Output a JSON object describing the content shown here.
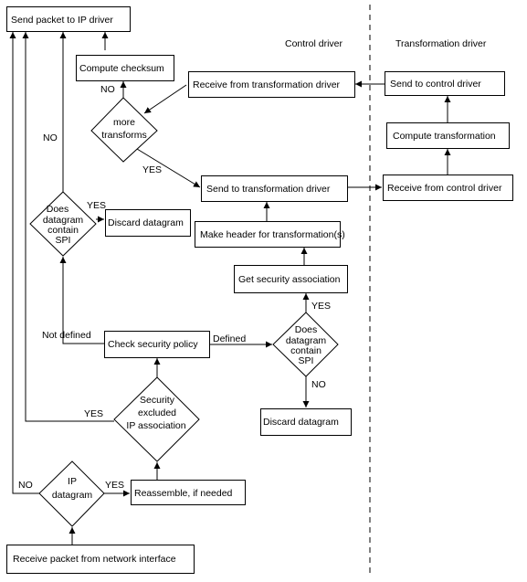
{
  "lanes": {
    "control": "Control driver",
    "transformation": "Transformation driver"
  },
  "boxes": {
    "send_ip": "Send packet to IP driver",
    "checksum": "Compute  checksum",
    "recv_transform": "Receive from transformation driver",
    "send_control": "Send to control driver",
    "compute_transform": "Compute  transformation",
    "recv_control": "Receive from control driver",
    "send_transform": "Send to transformation driver",
    "make_header": "Make header for transformation(s)",
    "get_sa": "Get security association",
    "discard_left": "Discard  datagram",
    "check_policy": "Check security policy",
    "discard_right": "Discard  datagram",
    "reassemble": "Reassemble,  if  needed",
    "recv_packet": "Receive packet  from network interface"
  },
  "decisions": {
    "more_transforms": [
      "more",
      "transforms"
    ],
    "spi_left": [
      "Does",
      "datagram",
      "contain",
      "SPI"
    ],
    "spi_right": [
      "Does",
      "datagram",
      "contain",
      "SPI"
    ],
    "security_excluded": [
      "Security",
      "excluded",
      "IP  association"
    ],
    "ip_datagram": [
      "IP",
      "datagram"
    ]
  },
  "labels": {
    "no_checksum": "NO",
    "yes_more": "YES",
    "no_spi_left": "NO",
    "yes_spi_left": "YES",
    "not_defined": "Not  defined",
    "defined": "Defined",
    "yes_spi_right": "YES",
    "no_spi_right": "NO",
    "yes_excluded": "YES",
    "no_ip": "NO",
    "yes_ip": "YES"
  }
}
